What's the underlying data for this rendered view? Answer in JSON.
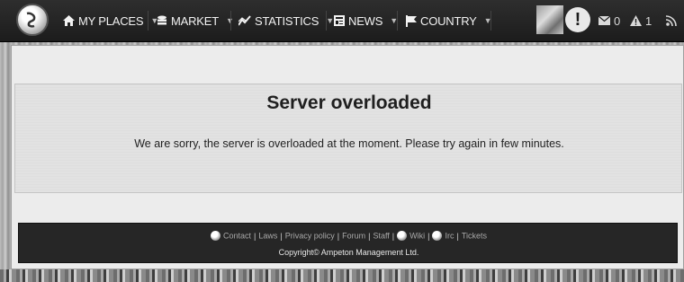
{
  "nav": {
    "items": [
      {
        "label": "MY PLACES",
        "icon": "home-icon"
      },
      {
        "label": "MARKET",
        "icon": "database-icon"
      },
      {
        "label": "STATISTICS",
        "icon": "chart-line-icon"
      },
      {
        "label": "NEWS",
        "icon": "newspaper-icon"
      },
      {
        "label": "COUNTRY",
        "icon": "flag-icon"
      }
    ],
    "alert_symbol": "!",
    "messages_count": "0",
    "alerts_count": "1"
  },
  "main": {
    "title": "Server overloaded",
    "message": "We are sorry, the server is overloaded at the moment. Please try again in few minutes."
  },
  "footer": {
    "links": [
      "Contact",
      "Laws",
      "Privacy policy",
      "Forum",
      "Staff",
      "Wiki",
      "Irc",
      "Tickets"
    ],
    "copyright": "Copyright© Ampeton Management Ltd."
  },
  "colors": {
    "navbar": "#1c1c1c",
    "footer": "#262626",
    "panel": "#e2e2e2"
  }
}
